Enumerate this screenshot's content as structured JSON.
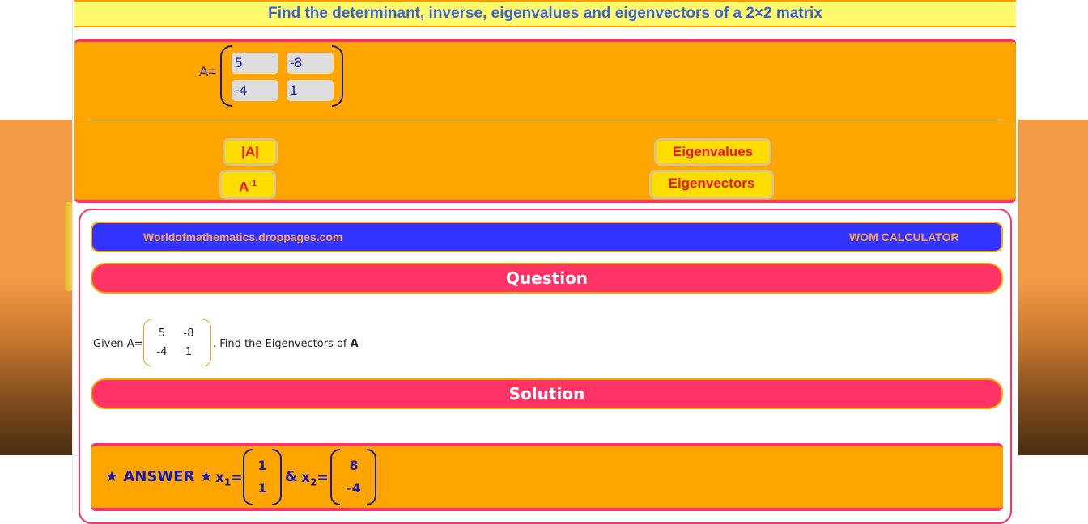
{
  "title": "Find the determinant, inverse, eigenvalues and eigenvectors of a 2×2 matrix",
  "matrix_input": {
    "label": "A=",
    "a11": "5",
    "a12": "-8",
    "a21": "-4",
    "a22": "1"
  },
  "buttons": {
    "determinant": "|A|",
    "inverse_base": "A",
    "inverse_sup": "-1",
    "eigenvalues": "Eigenvalues",
    "eigenvectors": "Eigenvectors"
  },
  "result": {
    "site": "Worldofmathematics.droppages.com",
    "brand": "WOM CALCULATOR",
    "question_heading": "Question",
    "solution_heading": "Solution",
    "question": {
      "given": "Given A=",
      "m11": "5",
      "m12": "-8",
      "m21": "-4",
      "m22": "1",
      "task_prefix": ". Find the Eigenvectors of ",
      "task_bold": "A"
    },
    "answer": {
      "label": "★ ANSWER ★",
      "x1_label": "x",
      "x1_sub": "1",
      "x1_top": "1",
      "x1_bottom": "1",
      "amp": "&",
      "x2_label": "x",
      "x2_sub": "2",
      "x2_top": "8",
      "x2_bottom": "-4",
      "eq": "="
    }
  },
  "colors": {
    "panel": "#ffa500",
    "accent": "#ff3366",
    "title_bg": "#fffb6a",
    "button_bg": "#ffdd00",
    "button_text": "#e8141e",
    "blue_bar": "#3333ff"
  }
}
